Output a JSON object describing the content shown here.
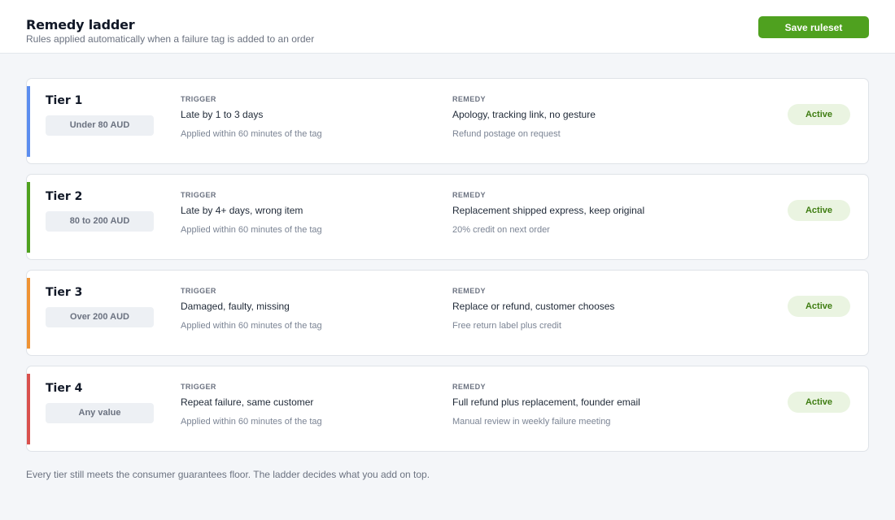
{
  "header": {
    "title": "Remedy ladder",
    "subtitle": "Rules applied automatically when a failure tag is added to an order",
    "save_label": "Save ruleset"
  },
  "tiers": [
    {
      "name": "Tier 1",
      "range": "Under 80 AUD",
      "color": "#5b8def",
      "trigger_label": "TRIGGER",
      "trigger": "Late by 1 to 3 days",
      "trigger_note": "Applied within 60 minutes of the tag",
      "remedy_label": "REMEDY",
      "remedy": "Apology, tracking link, no gesture",
      "remedy_note": "Refund postage on request",
      "status": "Active"
    },
    {
      "name": "Tier 2",
      "range": "80 to 200 AUD",
      "color": "#4fa11f",
      "trigger_label": "TRIGGER",
      "trigger": "Late by 4+ days, wrong item",
      "trigger_note": "Applied within 60 minutes of the tag",
      "remedy_label": "REMEDY",
      "remedy": "Replacement shipped express, keep original",
      "remedy_note": "20% credit on next order",
      "status": "Active"
    },
    {
      "name": "Tier 3",
      "range": "Over 200 AUD",
      "color": "#ef9334",
      "trigger_label": "TRIGGER",
      "trigger": "Damaged, faulty, missing",
      "trigger_note": "Applied within 60 minutes of the tag",
      "remedy_label": "REMEDY",
      "remedy": "Replace or refund, customer chooses",
      "remedy_note": "Free return label plus credit",
      "status": "Active"
    },
    {
      "name": "Tier 4",
      "range": "Any value",
      "color": "#d9514e",
      "trigger_label": "TRIGGER",
      "trigger": "Repeat failure, same customer",
      "trigger_note": "Applied within 60 minutes of the tag",
      "remedy_label": "REMEDY",
      "remedy": "Full refund plus replacement, founder email",
      "remedy_note": "Manual review in weekly failure meeting",
      "status": "Active"
    }
  ],
  "footnote": "Every tier still meets the consumer guarantees floor. The ladder decides what you add on top."
}
